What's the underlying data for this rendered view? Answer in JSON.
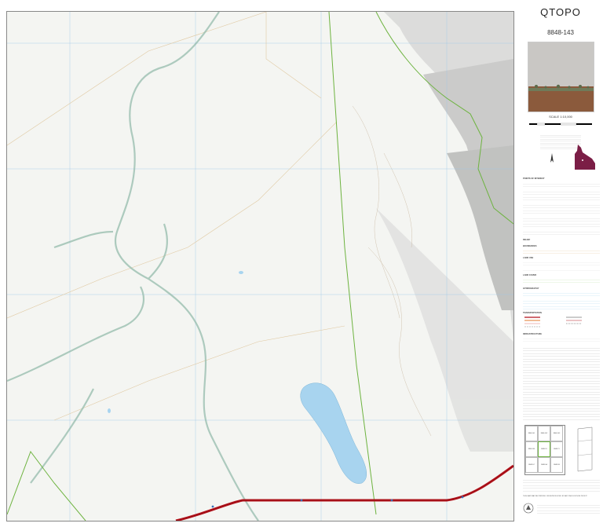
{
  "header": {
    "product": "QTOPO",
    "sheet_number": "8848-143",
    "scale": "SCALE 1:10,000"
  },
  "colors": {
    "background": "#f3f4f1",
    "grid": "#9cc6ea",
    "watercourse": "#8fb8a8",
    "vegetation_boundary": "#6db33f",
    "road": "#b5121b",
    "water": "#a8d4ef",
    "relief": "#9a9a9a",
    "contour": "#c9b8a0",
    "cadastre": "#d9c29a",
    "queensland": "#7b1e46"
  },
  "legend": {
    "points_of_interest_heading": "POINTS OF INTEREST",
    "relief_heading": "RELIEF",
    "boundaries_heading": "BOUNDARIES",
    "land_use_heading": "LAND USE",
    "land cover_heading": "LAND COVER",
    "hydrography_heading": "HYDROGRAPHY",
    "transportation_heading": "TRANSPORTATION",
    "infrastructure_heading": "INFRASTRUCTURE"
  },
  "footer": {
    "print_note": "THIS MAP MAY BE PRINTED OR REPRODUCED BY ANYONE FOR NON PROFIT"
  },
  "index_sheets": [
    {
      "label": "8848-141"
    },
    {
      "label": "8848-142"
    },
    {
      "label": "8848-143"
    },
    {
      "label": "8848-144"
    },
    {
      "label": "8848-1X"
    },
    {
      "label": "8848-1Y"
    },
    {
      "label": "8848-1Z"
    },
    {
      "label": "8848-1A"
    },
    {
      "label": "8848-1B"
    }
  ]
}
